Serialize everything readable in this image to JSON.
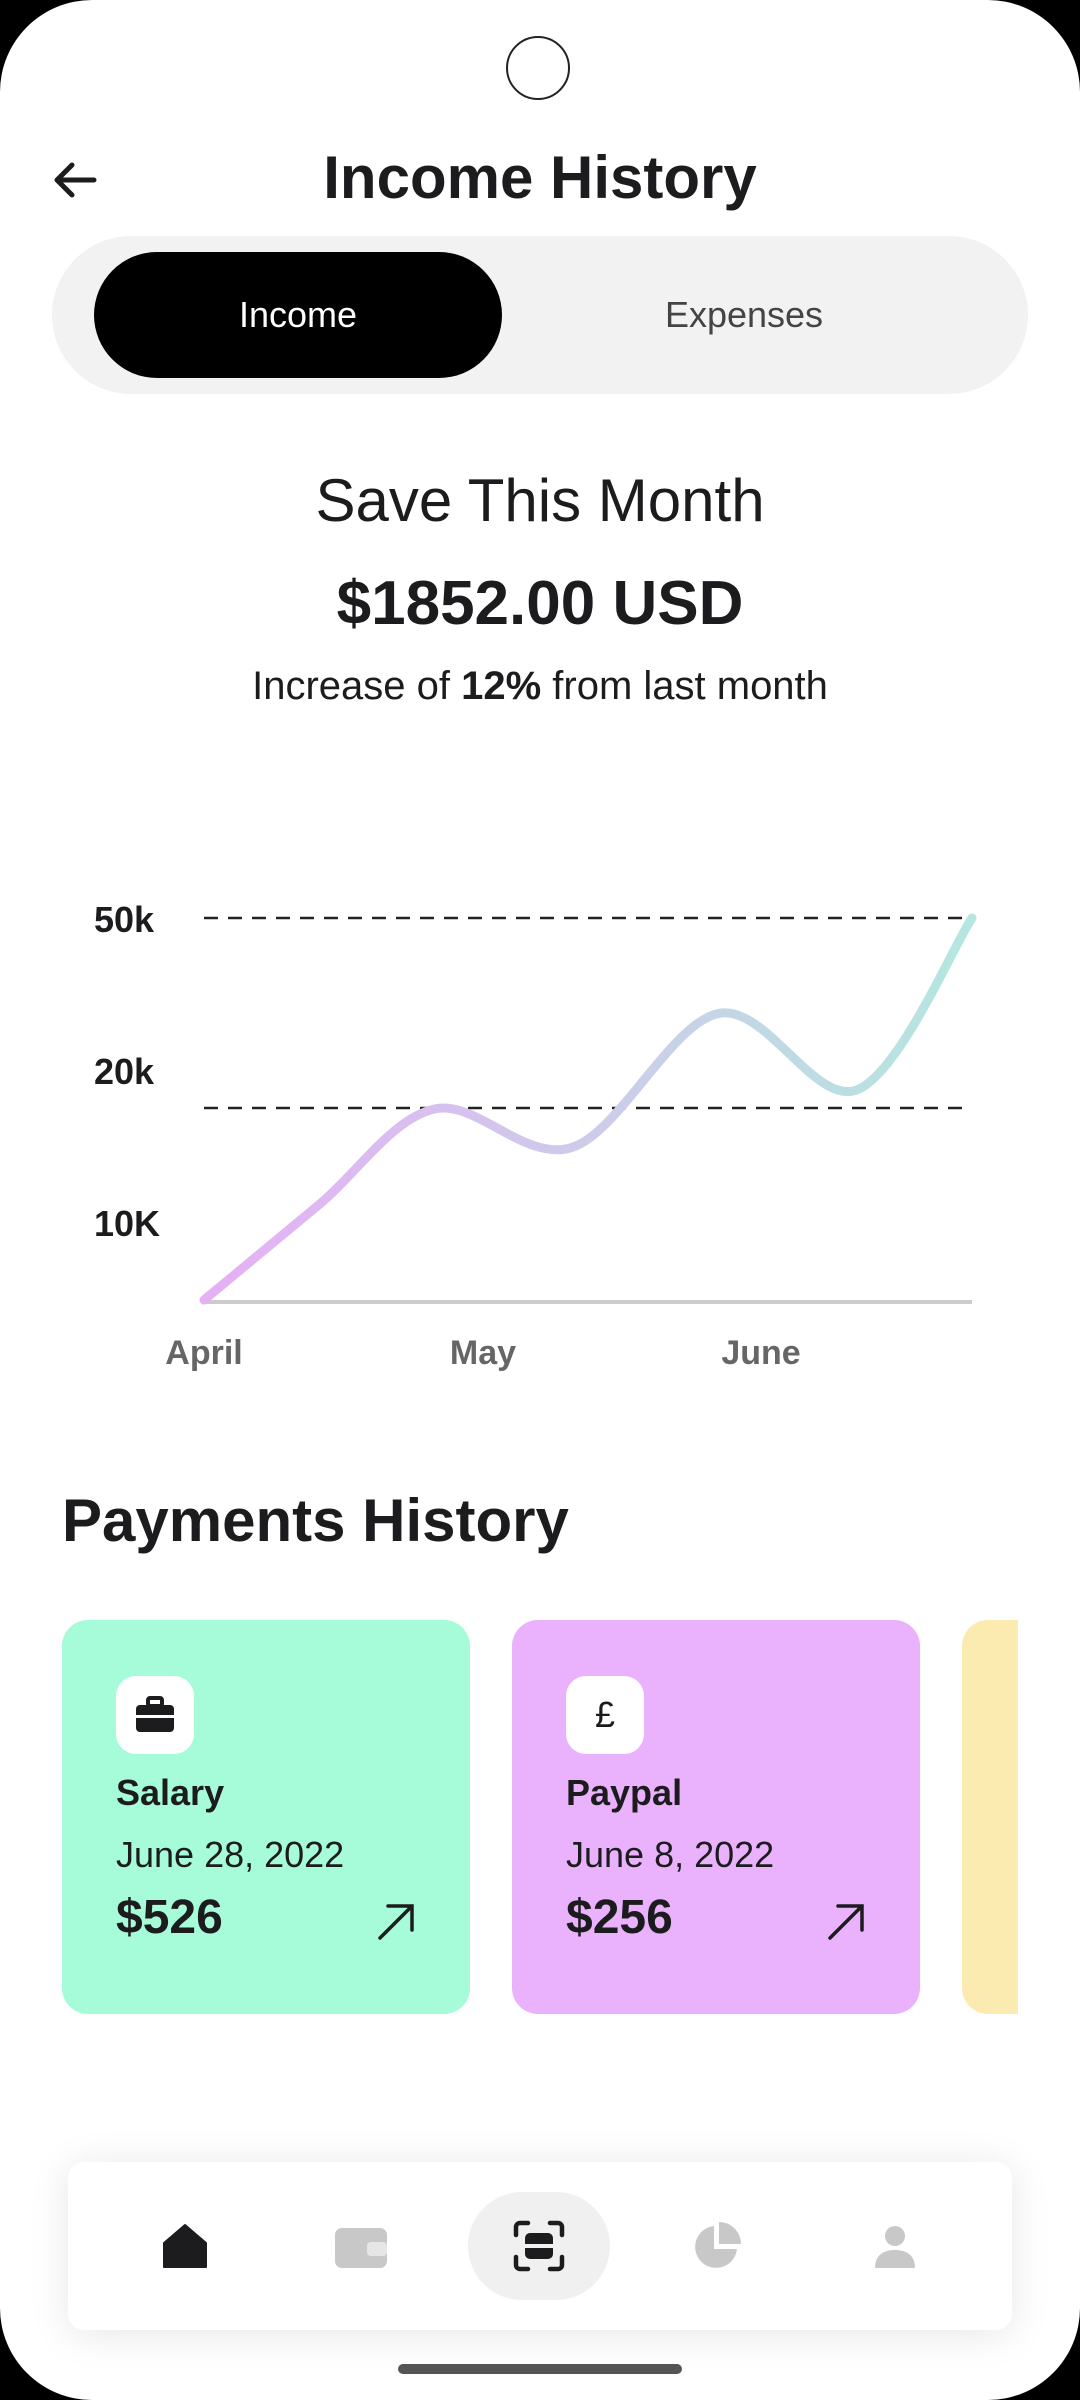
{
  "header": {
    "title": "Income History",
    "back_icon": "arrow-left-icon"
  },
  "segment": {
    "active": "Income",
    "inactive": "Expenses"
  },
  "summary": {
    "label": "Save This Month",
    "amount": "$1852.00 USD",
    "increase_prefix": "Increase of ",
    "increase_value": "12%",
    "increase_suffix": " from last month"
  },
  "chart_data": {
    "type": "line",
    "title": "",
    "xlabel": "",
    "ylabel": "",
    "categories": [
      "April",
      "May",
      "June"
    ],
    "ytick_labels": [
      "10K",
      "20k",
      "50k"
    ],
    "grid": "dashed lines at 20k and 50k",
    "gradient_colors": [
      "#e6b0f5",
      "#b4e7df"
    ],
    "series": [
      {
        "x": [
          0,
          0.15,
          0.3,
          0.48,
          0.67,
          0.85,
          1.0
        ],
        "y": [
          0,
          5,
          10,
          8,
          15,
          11,
          20
        ]
      }
    ]
  },
  "payments": {
    "title": "Payments History",
    "cards": [
      {
        "icon": "briefcase-icon",
        "name": "Salary",
        "date": "June 28, 2022",
        "amount": "$526",
        "color": "#a6fbd9"
      },
      {
        "icon_text": "£",
        "icon": "pound-icon",
        "name": "Paypal",
        "date": "June 8, 2022",
        "amount": "$256",
        "color": "#eab2fc"
      },
      {
        "color": "#fcebb0"
      }
    ]
  },
  "nav": {
    "items": [
      "home-icon",
      "wallet-icon",
      "scan-icon",
      "pie-chart-icon",
      "profile-icon"
    ],
    "active": "scan-icon"
  }
}
